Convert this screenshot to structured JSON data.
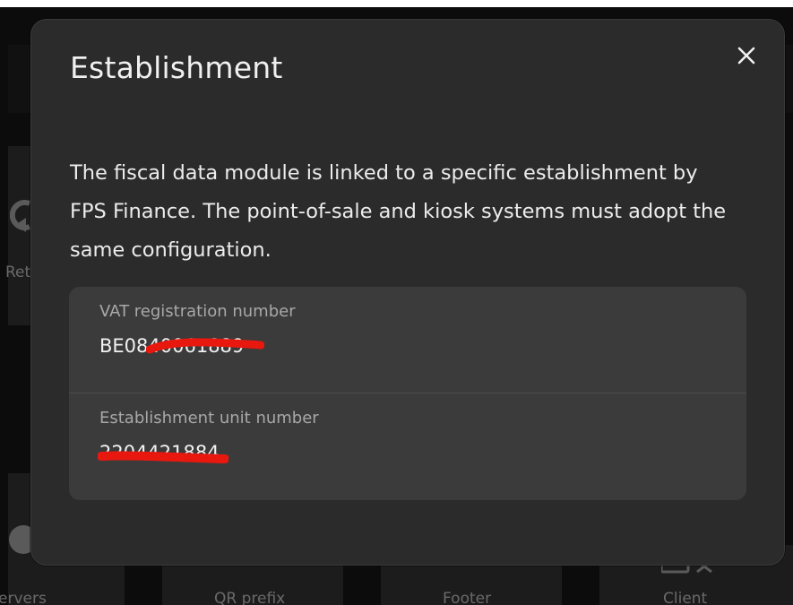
{
  "background": {
    "partial_left_text": "Ret",
    "bottom_tiles": [
      {
        "label": "ervers"
      },
      {
        "label": "QR prefix"
      },
      {
        "label": "Footer"
      },
      {
        "label": "Client"
      }
    ]
  },
  "modal": {
    "title": "Establishment",
    "close_icon": "close-icon",
    "description": "The fiscal data module is linked to a specific establishment by FPS Finance. The point-of-sale and kiosk systems must adopt the same configuration.",
    "fields": [
      {
        "label": "VAT registration number",
        "value": "BE0840061889"
      },
      {
        "label": "Establishment unit number",
        "value": "2204421884"
      }
    ]
  },
  "colors": {
    "backdrop": "#0c0c0c",
    "modal_background": "#2b2b2b",
    "field_group_background": "#3b3b3b",
    "redaction_mark": "#e8180f"
  }
}
